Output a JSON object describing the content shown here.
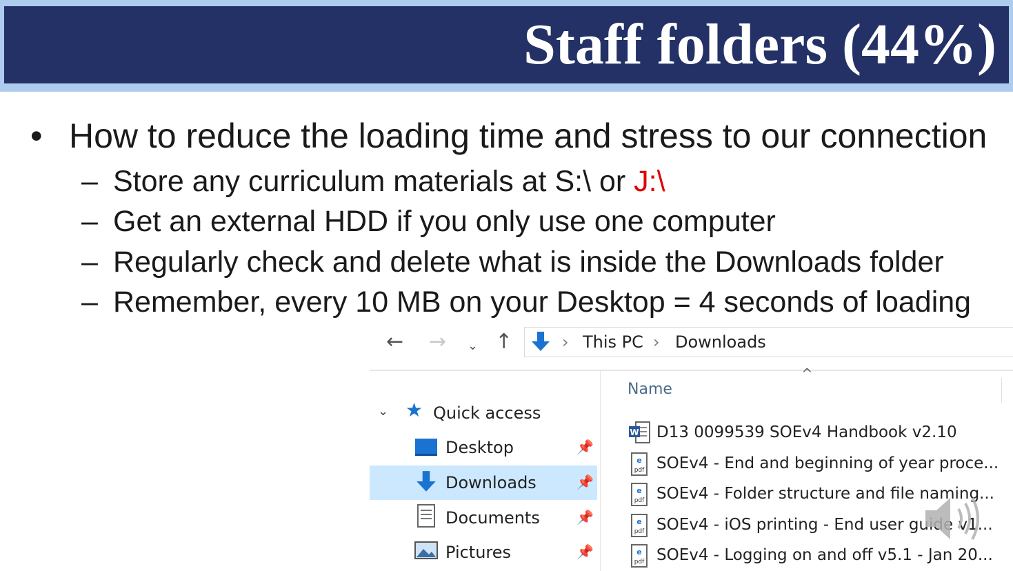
{
  "slide": {
    "title": "Staff folders (44%)",
    "bullet": "How to reduce the loading time and stress to our connection",
    "subs": [
      {
        "text": "Store any curriculum materials at S:\\ or ",
        "highlight": "J:\\"
      },
      {
        "text": "Get an external HDD if you only use one computer"
      },
      {
        "text": "Regularly check and delete what is inside the Downloads folder"
      },
      {
        "text": "Remember, every 10 MB on your Desktop = 4 seconds of loading"
      }
    ],
    "highlight_color": "#e00000"
  },
  "explorer": {
    "breadcrumb": [
      "This PC",
      "Downloads"
    ],
    "nav": {
      "quick_access": "Quick access",
      "items": [
        {
          "label": "Desktop",
          "icon": "desktop-icon",
          "pinned": true
        },
        {
          "label": "Downloads",
          "icon": "download-arrow-icon",
          "pinned": true,
          "selected": true
        },
        {
          "label": "Documents",
          "icon": "documents-icon",
          "pinned": true
        },
        {
          "label": "Pictures",
          "icon": "pictures-icon",
          "pinned": true
        }
      ]
    },
    "column_name": "Name",
    "files": [
      {
        "name": "D13 0099539  SOEv4 Handbook v2.10",
        "icon": "word-doc-icon"
      },
      {
        "name": "SOEv4 - End and beginning of year proce...",
        "icon": "pdf-icon"
      },
      {
        "name": "SOEv4 - Folder structure and file naming...",
        "icon": "pdf-icon"
      },
      {
        "name": "SOEv4 - iOS printing - End user guide v1...",
        "icon": "pdf-icon"
      },
      {
        "name": "SOEv4 - Logging on and off  v5.1 - Jan 20...",
        "icon": "pdf-icon"
      }
    ]
  },
  "colors": {
    "banner": "#243166",
    "banner_border": "#aecdee",
    "selection": "#cce8ff"
  }
}
